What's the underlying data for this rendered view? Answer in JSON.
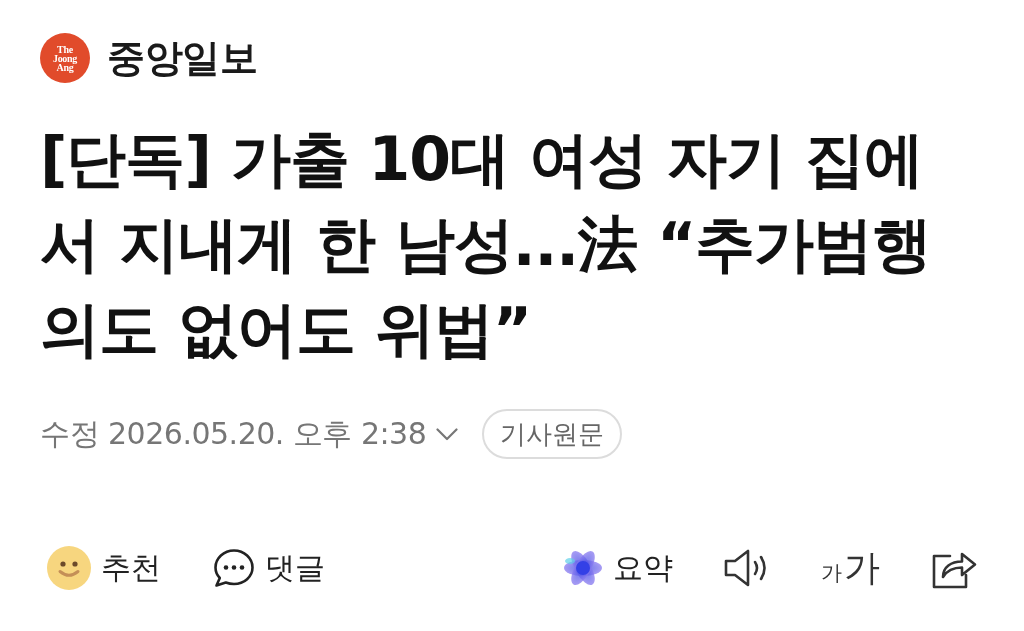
{
  "header": {
    "logo": {
      "lines": [
        "The",
        "Joong",
        "Ang"
      ]
    },
    "brand": "중앙일보"
  },
  "headline": "[단독] 가출 10대 여성 자기 집에서 지내게 한 남성...法 “추가범행 의도 없어도 위법”",
  "meta": {
    "date": "수정 2026.05.20. 오후 2:38",
    "original_button": "기사원문"
  },
  "reactions": [
    {
      "kind": "recommend",
      "label": "추천"
    },
    {
      "kind": "comment",
      "label": "댓글"
    }
  ],
  "tools": [
    {
      "kind": "summary",
      "label": "요약"
    },
    {
      "kind": "listen"
    },
    {
      "kind": "text_size",
      "small": "가",
      "large": "가"
    },
    {
      "kind": "share"
    }
  ]
}
